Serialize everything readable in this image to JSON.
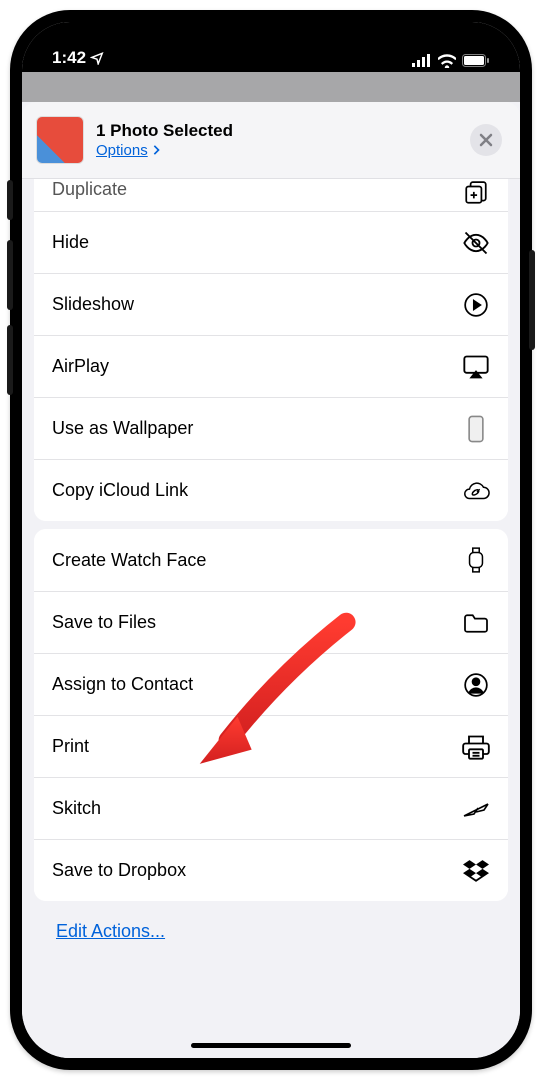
{
  "status": {
    "time": "1:42",
    "location_icon": "location-arrow"
  },
  "header": {
    "title": "1 Photo Selected",
    "options_label": "Options"
  },
  "section1": [
    {
      "label": "Duplicate",
      "icon": "duplicate",
      "cut": true
    },
    {
      "label": "Hide",
      "icon": "eye-slash"
    },
    {
      "label": "Slideshow",
      "icon": "play-circle"
    },
    {
      "label": "AirPlay",
      "icon": "airplay"
    },
    {
      "label": "Use as Wallpaper",
      "icon": "phone-rect"
    },
    {
      "label": "Copy iCloud Link",
      "icon": "cloud-link"
    }
  ],
  "section2": [
    {
      "label": "Create Watch Face",
      "icon": "watch"
    },
    {
      "label": "Save to Files",
      "icon": "folder"
    },
    {
      "label": "Assign to Contact",
      "icon": "person-circle"
    },
    {
      "label": "Print",
      "icon": "printer"
    },
    {
      "label": "Skitch",
      "icon": "feather"
    },
    {
      "label": "Save to Dropbox",
      "icon": "dropbox"
    }
  ],
  "footer": {
    "edit_label": "Edit Actions..."
  }
}
